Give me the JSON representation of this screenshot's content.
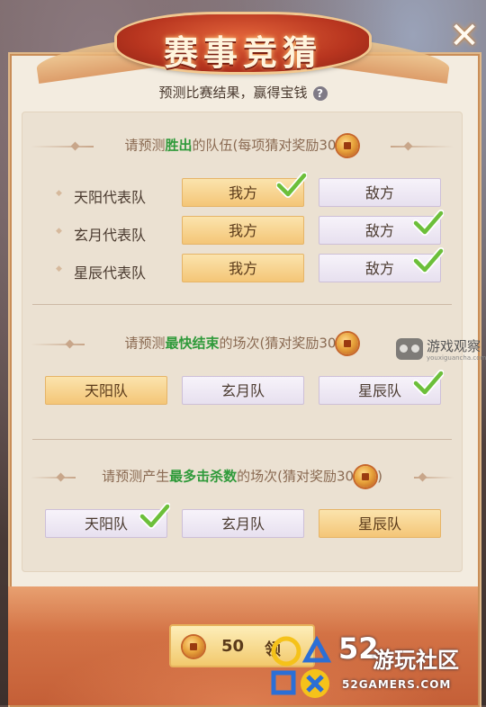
{
  "window": {
    "title": "赛事竞猜",
    "close_label": "✕"
  },
  "subtitle": "预测比赛结果，赢得宝钱",
  "help_label": "?",
  "sections": [
    {
      "prefix": "请预测",
      "highlight": "胜出",
      "suffix": "的队伍(每项猜对奖励30",
      "suffix_end": "",
      "rows": [
        {
          "team": "天阳代表队",
          "options": [
            {
              "label": "我方",
              "style": "gold",
              "checked": true
            },
            {
              "label": "敌方",
              "style": "lav",
              "checked": false
            }
          ]
        },
        {
          "team": "玄月代表队",
          "options": [
            {
              "label": "我方",
              "style": "gold",
              "checked": false
            },
            {
              "label": "敌方",
              "style": "lav",
              "checked": true
            }
          ]
        },
        {
          "team": "星辰代表队",
          "options": [
            {
              "label": "我方",
              "style": "gold",
              "checked": false
            },
            {
              "label": "敌方",
              "style": "lav",
              "checked": true
            }
          ]
        }
      ]
    },
    {
      "prefix": "请预测",
      "highlight": "最快结束",
      "suffix": "的场次(猜对奖励30",
      "suffix_end": "",
      "options": [
        {
          "label": "天阳队",
          "style": "gold",
          "checked": false
        },
        {
          "label": "玄月队",
          "style": "lav",
          "checked": false
        },
        {
          "label": "星辰队",
          "style": "lav",
          "checked": true
        }
      ]
    },
    {
      "prefix": "请预测产生",
      "highlight": "最多击杀数",
      "suffix": "的场次(猜对奖励30",
      "suffix_end": ")",
      "options": [
        {
          "label": "天阳队",
          "style": "lav",
          "checked": true
        },
        {
          "label": "玄月队",
          "style": "lav",
          "checked": false
        },
        {
          "label": "星辰队",
          "style": "gold",
          "checked": false
        }
      ]
    }
  ],
  "claim": {
    "amount": "50",
    "label": "领"
  },
  "watermarks": {
    "site1_name": "游戏观察",
    "site1_url": "youxiguancha.com",
    "site2_num": "52",
    "site2_name": "游玩社区",
    "site2_url": "52GAMERS.COM"
  },
  "colors": {
    "highlight": "#2f9a3a",
    "check": "#6cbf3a",
    "gold_button": "#f4c677",
    "lavender_button": "#e7e0ef"
  }
}
